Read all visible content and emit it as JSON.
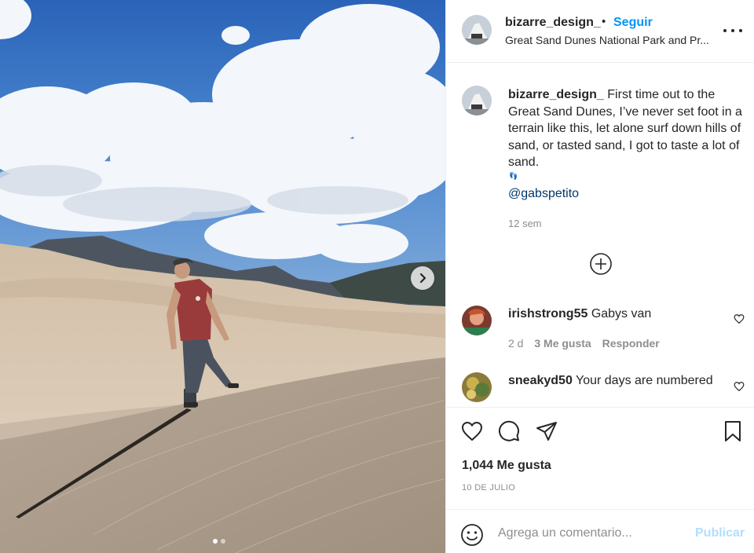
{
  "post": {
    "photo": {
      "alt_icon": "sand-dunes-photo",
      "next_icon": "chevron-right-icon",
      "carousel_dots": 2,
      "active_dot": 0
    },
    "header": {
      "username": "bizarre_design_",
      "separator": "•",
      "follow_label": "Seguir",
      "location": "Great Sand Dunes National Park and Pr...",
      "more_icon": "more-options-icon"
    },
    "caption": {
      "username": "bizarre_design_",
      "text": "First time out to the Great Sand Dunes, I’ve never set foot in a terrain like this, let alone surf down hills of sand, or tasted sand, I got to taste a lot of sand.",
      "emoji": "👣",
      "mention": "@gabspetito",
      "time_ago": "12 sem"
    },
    "load_more_icon": "plus-circle-icon",
    "comments": [
      {
        "username": "irishstrong55",
        "text": "Gabys van",
        "time": "2 d",
        "likes": "3 Me gusta",
        "reply": "Responder"
      },
      {
        "username": "sneakyd50",
        "text": "Your days are numbered"
      }
    ],
    "actions": {
      "like_icon": "heart-icon",
      "comment_icon": "comment-icon",
      "share_icon": "share-icon",
      "save_icon": "bookmark-icon"
    },
    "likes_count": "1,044 Me gusta",
    "date": "10 DE JULIO",
    "add_comment": {
      "placeholder": "Agrega un comentario...",
      "publish_label": "Publicar"
    }
  },
  "colors": {
    "accent": "#0095f6",
    "publish_disabled": "#b2dffc",
    "secondary_text": "#8e8e8e",
    "mention": "#00376b"
  }
}
